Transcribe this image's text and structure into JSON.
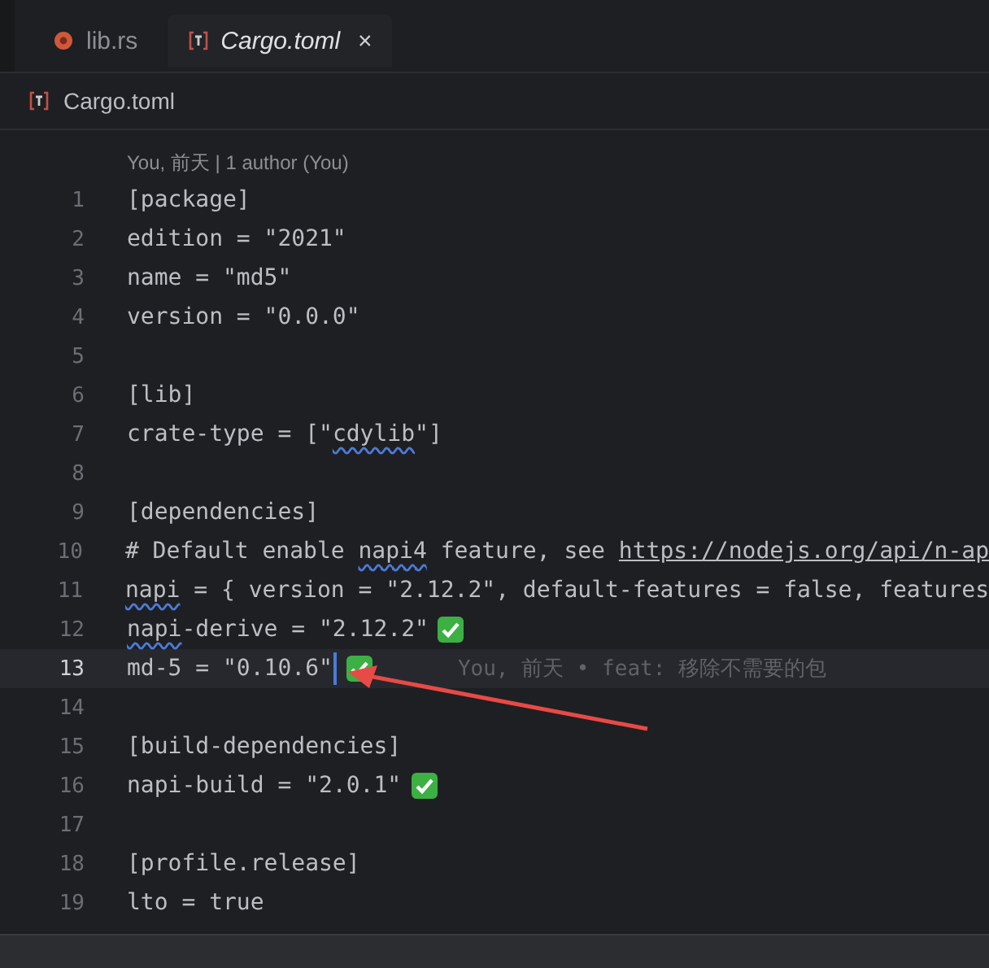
{
  "tabs": [
    {
      "label": "lib.rs",
      "kind": "rust",
      "selected": false
    },
    {
      "label": "Cargo.toml",
      "kind": "toml",
      "selected": true,
      "close": "×"
    }
  ],
  "breadcrumb": {
    "label": "Cargo.toml"
  },
  "code_lens": "You, 前天 | 1 author (You)",
  "lines": [
    {
      "num": "1",
      "current": false,
      "check": false,
      "parts": [
        {
          "t": "[package]"
        }
      ]
    },
    {
      "num": "2",
      "current": false,
      "check": false,
      "parts": [
        {
          "t": "edition = \"2021\""
        }
      ]
    },
    {
      "num": "3",
      "current": false,
      "check": false,
      "parts": [
        {
          "t": "name = \"md5\""
        }
      ]
    },
    {
      "num": "4",
      "current": false,
      "check": false,
      "parts": [
        {
          "t": "version = \"0.0.0\""
        }
      ]
    },
    {
      "num": "5",
      "current": false,
      "check": false
    },
    {
      "num": "6",
      "current": false,
      "check": false,
      "parts": [
        {
          "t": "[lib]"
        }
      ]
    },
    {
      "num": "7",
      "current": false,
      "check": false,
      "parts": [
        {
          "t": "crate-type = [\""
        },
        {
          "t": "cdylib",
          "kind": "squiggle"
        },
        {
          "t": "\"]"
        }
      ]
    },
    {
      "num": "8",
      "current": false,
      "check": false
    },
    {
      "num": "9",
      "current": false,
      "check": false,
      "parts": [
        {
          "t": "[dependencies]"
        }
      ]
    },
    {
      "num": "10",
      "current": false,
      "check": false,
      "parts": [
        {
          "t": "# Default enable "
        },
        {
          "t": "napi4",
          "kind": "squiggle"
        },
        {
          "t": " feature, see "
        },
        {
          "t": "https://nodejs.org/api/n-ap",
          "kind": "link"
        }
      ]
    },
    {
      "num": "11",
      "current": false,
      "check": false,
      "parts": [
        {
          "t": "napi",
          "kind": "squiggle"
        },
        {
          "t": " = { version = \"2.12.2\", default-features = false, features"
        }
      ]
    },
    {
      "num": "12",
      "current": false,
      "check": true,
      "parts": [
        {
          "t": "napi",
          "kind": "squiggle"
        },
        {
          "t": "-derive = \"2.12.2\""
        }
      ]
    },
    {
      "num": "13",
      "current": true,
      "check": true,
      "blame": "You, 前天 • feat: 移除不需要的包",
      "parts": [
        {
          "t": "md-5 = \"0.10.6\""
        }
      ]
    },
    {
      "num": "14",
      "current": false,
      "check": false
    },
    {
      "num": "15",
      "current": false,
      "check": false,
      "parts": [
        {
          "t": "[build-dependencies]"
        }
      ]
    },
    {
      "num": "16",
      "current": false,
      "check": true,
      "parts": [
        {
          "t": "napi-build = \"2.0.1\""
        }
      ]
    },
    {
      "num": "17",
      "current": false,
      "check": false
    },
    {
      "num": "18",
      "current": false,
      "check": false,
      "parts": [
        {
          "t": "[profile.release]"
        }
      ]
    },
    {
      "num": "19",
      "current": false,
      "check": false,
      "parts": [
        {
          "t": "lto = true"
        }
      ]
    }
  ]
}
